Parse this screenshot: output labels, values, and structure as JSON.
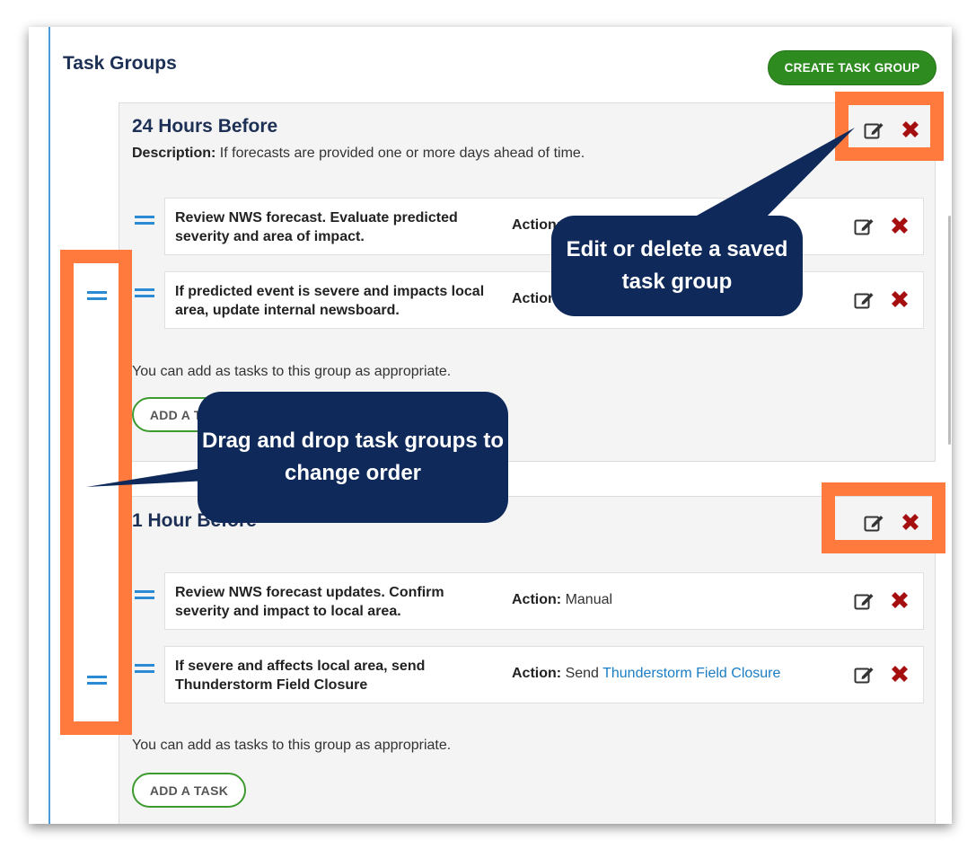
{
  "page": {
    "title": "Task Groups",
    "create_button": "CREATE TASK GROUP"
  },
  "groups": [
    {
      "title": "24 Hours Before",
      "description_label": "Description:",
      "description": "If forecasts are provided one or more days ahead of time.",
      "tasks": [
        {
          "name": "Review NWS forecast. Evaluate predicted severity and area of impact.",
          "action_label": "Action:",
          "action_value": "",
          "action_link": ""
        },
        {
          "name": "If predicted event is severe and impacts local area, update internal newsboard.",
          "action_label": "Action:",
          "action_value": "",
          "action_link": ""
        }
      ],
      "note": "You can add as tasks to this group as appropriate.",
      "add_button": "ADD A TASK"
    },
    {
      "title": "1 Hour Before",
      "tasks": [
        {
          "name": "Review NWS forecast updates. Confirm severity and impact to local area.",
          "action_label": "Action:",
          "action_value": "Manual",
          "action_link": ""
        },
        {
          "name": "If severe and affects local area, send Thunderstorm Field Closure",
          "action_label": "Action:",
          "action_value": "Send",
          "action_link": "Thunderstorm Field Closure"
        }
      ],
      "note": "You can add as tasks to this group as appropriate.",
      "add_button": "ADD A TASK"
    }
  ],
  "annotations": {
    "edit_delete": "Edit or delete a saved task group",
    "drag_drop": "Drag and drop  task groups to change order"
  },
  "icons": {
    "edit": "edit-icon",
    "delete": "delete-x-icon",
    "drag": "drag-handle-icon"
  },
  "colors": {
    "title": "#1c2f55",
    "primary_green": "#2e8b1f",
    "delete_red": "#a50f0f",
    "link_blue": "#1a7dc4",
    "handle_blue": "#2a8ad4",
    "highlight_orange": "#ff7a3c",
    "callout_navy": "#0f2a5a"
  }
}
